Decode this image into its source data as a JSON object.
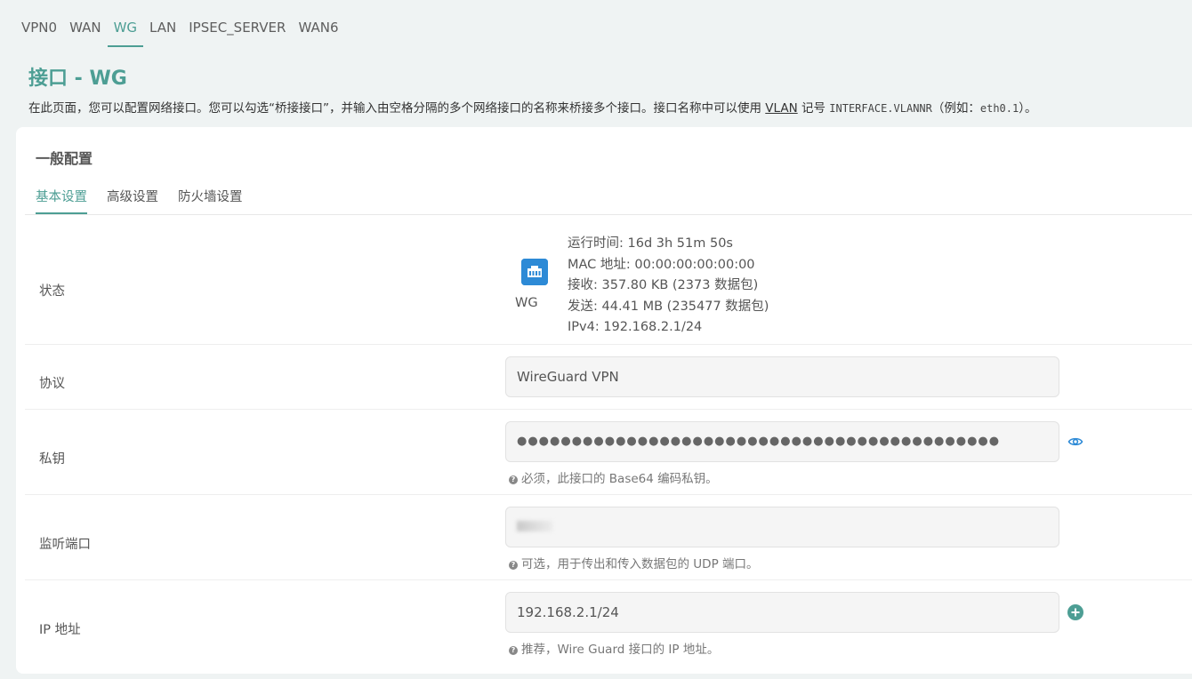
{
  "top_tabs": [
    "VPN0",
    "WAN",
    "WG",
    "LAN",
    "IPSEC_SERVER",
    "WAN6"
  ],
  "active_top_tab": "WG",
  "page": {
    "title": "接口 - WG",
    "desc_part1": "在此页面，您可以配置网络接口。您可以勾选“桥接接口”，并输入由空格分隔的多个网络接口的名称来桥接多个接口。接口名称中可以使用 ",
    "desc_vlan": "VLAN",
    "desc_part2": " 记号 ",
    "desc_code1": "INTERFACE.VLANNR",
    "desc_part3": "（例如：",
    "desc_code2": "eth0.1",
    "desc_part4": "）。"
  },
  "section": {
    "title": "一般配置",
    "tabs": [
      "基本设置",
      "高级设置",
      "防火墙设置"
    ]
  },
  "status": {
    "label": "状态",
    "icon": "ethernet-port-icon",
    "icon_name": "WG",
    "uptime": "运行时间: 16d 3h 51m 50s",
    "mac": "MAC 地址: 00:00:00:00:00:00",
    "rx": "接收: 357.80 KB (2373 数据包)",
    "tx": "发送: 44.41 MB (235477 数据包)",
    "ipv4": "IPv4: 192.168.2.1/24"
  },
  "protocol": {
    "label": "协议",
    "value": "WireGuard VPN"
  },
  "private_key": {
    "label": "私钥",
    "value": "●●●●●●●●●●●●●●●●●●●●●●●●●●●●●●●●●●●●●●●●●●●●",
    "hint": "必须，此接口的 Base64 编码私钥。",
    "reveal_icon": "eye-icon"
  },
  "listen_port": {
    "label": "监听端口",
    "hint": "可选，用于传出和传入数据包的 UDP 端口。"
  },
  "ip_address": {
    "label": "IP 地址",
    "value": "192.168.2.1/24",
    "hint": "推荐，Wire Guard 接口的 IP 地址。",
    "add_icon": "plus-circle-icon"
  },
  "colors": {
    "accent": "#4d9e94",
    "icon_blue": "#2d8ad6"
  }
}
